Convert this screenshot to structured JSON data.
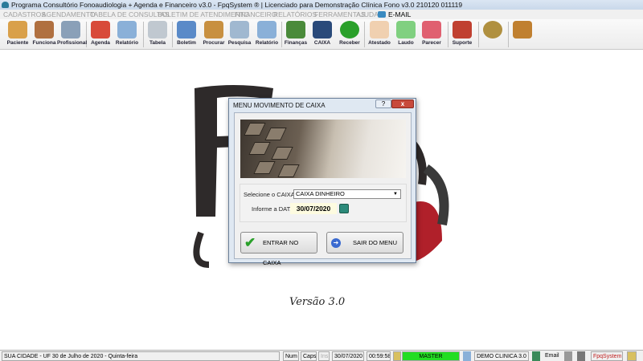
{
  "window": {
    "title": "Programa Consultório Fonoaudiologia + Agenda e Financeiro v3.0 - FpqSystem ® | Licenciado para  Demonstração Clínica Fono v3.0 210120 011119"
  },
  "menu": [
    "CADASTROS",
    "AGENDAMENTO",
    "TABELA DE CONSULTAS",
    "BOLETIM DE ATENDIMENTO",
    "FINANCEIRO",
    "RELATÓRIOS",
    "FERRAMENTAS",
    "AJUDA",
    "E-MAIL"
  ],
  "toolbar": [
    {
      "label": "Paciente",
      "icon": "patient-icon",
      "color": "#d9a04a"
    },
    {
      "label": "Funciona",
      "icon": "employee-icon",
      "color": "#b07040"
    },
    {
      "label": "Profissional",
      "icon": "doctor-icon",
      "color": "#8aa0b8"
    },
    {
      "label": "Agenda",
      "icon": "calendar-icon",
      "color": "#d84a3a"
    },
    {
      "label": "Relatório",
      "icon": "printer-icon",
      "color": "#8ab0d8"
    },
    {
      "label": "Tabela",
      "icon": "document-icon",
      "color": "#c0c8d0"
    },
    {
      "label": "Boletim",
      "icon": "bulletin-icon",
      "color": "#5a8ac8"
    },
    {
      "label": "Procurar",
      "icon": "folder-icon",
      "color": "#c89040"
    },
    {
      "label": "Pesquisa",
      "icon": "search-icon",
      "color": "#a0b8d0"
    },
    {
      "label": "Relatório",
      "icon": "printer-icon",
      "color": "#8ab0d8"
    },
    {
      "label": "Finanças",
      "icon": "finance-icon",
      "color": "#4a8a3a"
    },
    {
      "label": "CAIXA",
      "icon": "cashbook-icon",
      "color": "#2a4a7a"
    },
    {
      "label": "Receber",
      "icon": "dollar-icon",
      "color": "#2aa02a"
    },
    {
      "label": "Atestado",
      "icon": "certificate-icon",
      "color": "#f0d0b0"
    },
    {
      "label": "Laudo",
      "icon": "report-icon",
      "color": "#80d080"
    },
    {
      "label": "Parecer",
      "icon": "opinion-icon",
      "color": "#e06070"
    },
    {
      "label": "Suporte",
      "icon": "support-icon",
      "color": "#c04030"
    },
    {
      "label": "",
      "icon": "coin-icon",
      "color": "#b09040"
    },
    {
      "label": "",
      "icon": "exit-icon",
      "color": "#c08030"
    }
  ],
  "background": {
    "version": "Versão 3.0"
  },
  "dialog": {
    "title": "MENU MOVIMENTO DE CAIXA",
    "help": "?",
    "close": "x",
    "select_label": "Selecione o CAIXA",
    "select_value": "CAIXA DINHEIRO",
    "date_label": "Informe a DATA",
    "date_value": "30/07/2020",
    "enter_button": "ENTRAR NO CAIXA",
    "exit_button": "SAIR DO MENU"
  },
  "status": {
    "city": "SUA CIDADE - UF 30 de Julho de 2020 - Quinta-feira",
    "num": "Num",
    "caps": "Caps",
    "ins": "Ins",
    "date": "30/07/2020",
    "time": "00:59:58",
    "user": "MASTER",
    "user_color": "#22dd22",
    "company": "DEMO CLINICA 3.0",
    "email": "Email",
    "brand": "FpqSystem"
  }
}
